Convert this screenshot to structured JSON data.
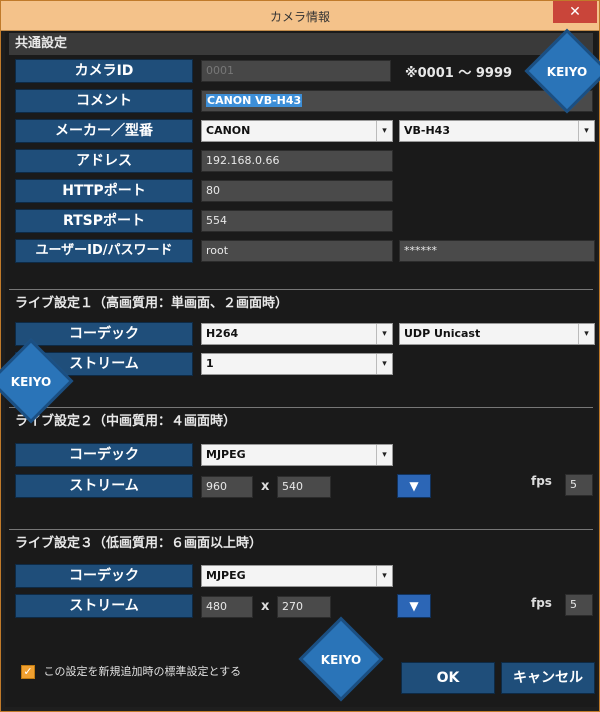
{
  "window": {
    "title": "カメラ情報",
    "close": "✕"
  },
  "common": {
    "title": "共通設定",
    "labels": {
      "camera_id": "カメラID",
      "comment": "コメント",
      "maker": "メーカー／型番",
      "address": "アドレス",
      "http": "HTTPポート",
      "rtsp": "RTSPポート",
      "user": "ユーザーID/パスワード"
    },
    "camera_id_value": "0001",
    "camera_id_note": "※0001 ～ 9999",
    "comment_value": "CANON VB-H43",
    "maker_value": "CANON",
    "model_value": "VB-H43",
    "address_value": "192.168.0.66",
    "http_value": "80",
    "rtsp_value": "554",
    "user_value": "root",
    "password_value": "******"
  },
  "live1": {
    "title": "ライブ設定１（高画質用：単画面、２画面時）",
    "codec_label": "コーデック",
    "stream_label": "ストリーム",
    "codec_value": "H264",
    "transport_value": "UDP Unicast",
    "stream_value": "1"
  },
  "live2": {
    "title": "ライブ設定２（中画質用：４画面時）",
    "codec_label": "コーデック",
    "stream_label": "ストリーム",
    "codec_value": "MJPEG",
    "width": "960",
    "height": "540",
    "times": "x",
    "fps_label": "fps",
    "fps_value": "5"
  },
  "live3": {
    "title": "ライブ設定３（低画質用：６画面以上時）",
    "codec_label": "コーデック",
    "stream_label": "ストリーム",
    "codec_value": "MJPEG",
    "width": "480",
    "height": "270",
    "times": "x",
    "fps_label": "fps",
    "fps_value": "5"
  },
  "footer": {
    "default_checkbox_label": "この設定を新規追加時の標準設定とする",
    "ok": "OK",
    "cancel": "キャンセル"
  },
  "watermark": "KEIYO",
  "icons": {
    "dropdown": "▾",
    "down_arrow": "▼",
    "check": "✓"
  },
  "colors": {
    "label_bg": "#1f4e7a",
    "title_bar": "#f4c28a",
    "accent_button": "#2c66b6"
  }
}
